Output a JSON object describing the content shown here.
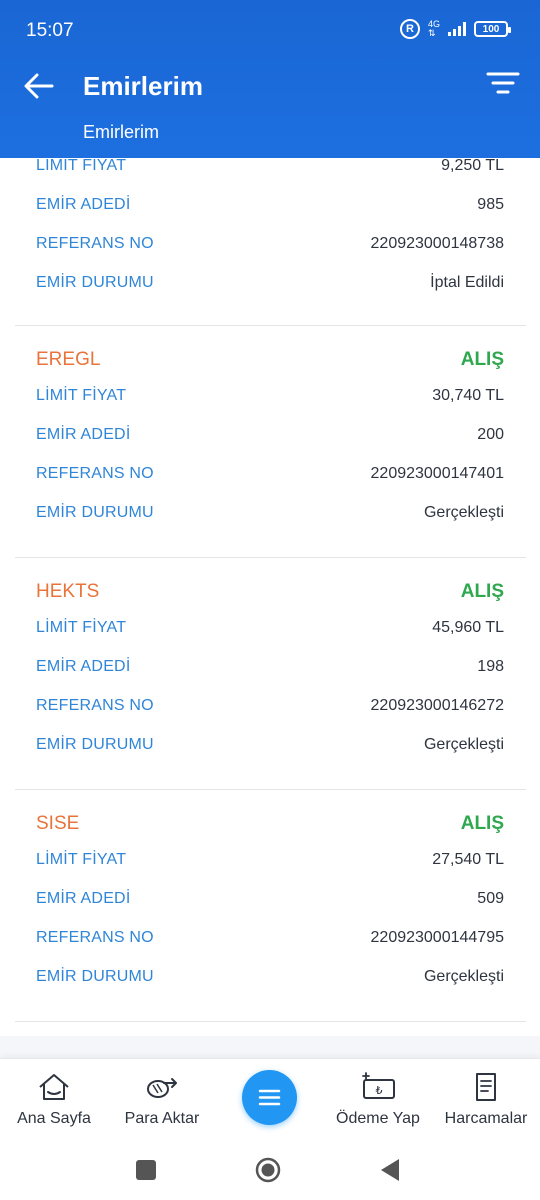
{
  "status": {
    "time": "15:07",
    "network": "4G",
    "battery": "100",
    "r_badge": "R"
  },
  "header": {
    "title": "Emirlerim",
    "subtitle": "Emirlerim"
  },
  "partial_order": {
    "rows": [
      {
        "label": "LİMİT FİYAT",
        "value": "9,250 TL"
      },
      {
        "label": "EMİR ADEDİ",
        "value": "985"
      },
      {
        "label": "REFERANS NO",
        "value": "220923000148738"
      },
      {
        "label": "EMİR DURUMU",
        "value": "İptal Edildi"
      }
    ]
  },
  "orders": [
    {
      "symbol": "EREGL",
      "side": "ALIŞ",
      "rows": [
        {
          "label": "LİMİT FİYAT",
          "value": "30,740 TL"
        },
        {
          "label": "EMİR ADEDİ",
          "value": "200"
        },
        {
          "label": "REFERANS NO",
          "value": "220923000147401"
        },
        {
          "label": "EMİR DURUMU",
          "value": "Gerçekleşti"
        }
      ]
    },
    {
      "symbol": "HEKTS",
      "side": "ALIŞ",
      "rows": [
        {
          "label": "LİMİT FİYAT",
          "value": "45,960 TL"
        },
        {
          "label": "EMİR ADEDİ",
          "value": "198"
        },
        {
          "label": "REFERANS NO",
          "value": "220923000146272"
        },
        {
          "label": "EMİR DURUMU",
          "value": "Gerçekleşti"
        }
      ]
    },
    {
      "symbol": "SISE",
      "side": "ALIŞ",
      "rows": [
        {
          "label": "LİMİT FİYAT",
          "value": "27,540 TL"
        },
        {
          "label": "EMİR ADEDİ",
          "value": "509"
        },
        {
          "label": "REFERANS NO",
          "value": "220923000144795"
        },
        {
          "label": "EMİR DURUMU",
          "value": "Gerçekleşti"
        }
      ]
    }
  ],
  "bottom_nav": {
    "items": [
      {
        "label": "Ana Sayfa",
        "icon": "home-icon"
      },
      {
        "label": "Para Aktar",
        "icon": "money-transfer-icon"
      },
      {
        "label": "",
        "icon": "menu-icon"
      },
      {
        "label": "Ödeme Yap",
        "icon": "payment-icon"
      },
      {
        "label": "Harcamalar",
        "icon": "receipt-icon"
      }
    ]
  },
  "colors": {
    "header": "#1a66d4",
    "label": "#2f86d8",
    "symbol": "#e8743b",
    "buy": "#2fa84f",
    "center_button": "#2196f3"
  }
}
